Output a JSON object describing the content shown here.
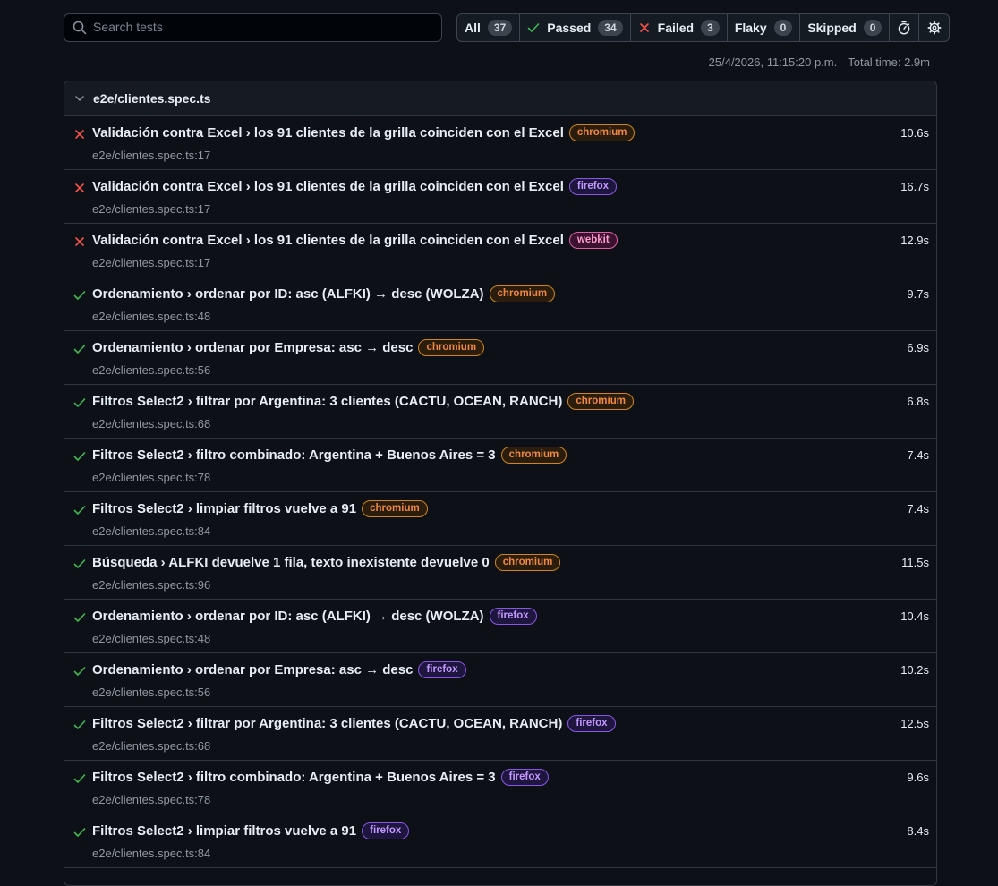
{
  "search": {
    "placeholder": "Search tests",
    "value": ""
  },
  "filters": [
    {
      "id": "all",
      "label": "All",
      "count": "37"
    },
    {
      "id": "passed",
      "label": "Passed",
      "count": "34"
    },
    {
      "id": "failed",
      "label": "Failed",
      "count": "3"
    },
    {
      "id": "flaky",
      "label": "Flaky",
      "count": "0"
    },
    {
      "id": "skipped",
      "label": "Skipped",
      "count": "0"
    }
  ],
  "meta": {
    "timestamp": "25/4/2026, 11:15:20 p.m.",
    "total_time": "Total time: 2.9m"
  },
  "file": {
    "name": "e2e/clientes.spec.ts",
    "tests": [
      {
        "status": "failed",
        "title": "Validación contra Excel › los 91 clientes de la grilla coinciden con el Excel",
        "project": "chromium",
        "location": "e2e/clientes.spec.ts:17",
        "duration": "10.6s"
      },
      {
        "status": "failed",
        "title": "Validación contra Excel › los 91 clientes de la grilla coinciden con el Excel",
        "project": "firefox",
        "location": "e2e/clientes.spec.ts:17",
        "duration": "16.7s"
      },
      {
        "status": "failed",
        "title": "Validación contra Excel › los 91 clientes de la grilla coinciden con el Excel",
        "project": "webkit",
        "location": "e2e/clientes.spec.ts:17",
        "duration": "12.9s"
      },
      {
        "status": "passed",
        "title": "Ordenamiento › ordenar por ID: asc (ALFKI) → desc (WOLZA)",
        "project": "chromium",
        "location": "e2e/clientes.spec.ts:48",
        "duration": "9.7s"
      },
      {
        "status": "passed",
        "title": "Ordenamiento › ordenar por Empresa: asc → desc",
        "project": "chromium",
        "location": "e2e/clientes.spec.ts:56",
        "duration": "6.9s"
      },
      {
        "status": "passed",
        "title": "Filtros Select2 › filtrar por Argentina: 3 clientes (CACTU, OCEAN, RANCH)",
        "project": "chromium",
        "location": "e2e/clientes.spec.ts:68",
        "duration": "6.8s"
      },
      {
        "status": "passed",
        "title": "Filtros Select2 › filtro combinado: Argentina + Buenos Aires = 3",
        "project": "chromium",
        "location": "e2e/clientes.spec.ts:78",
        "duration": "7.4s"
      },
      {
        "status": "passed",
        "title": "Filtros Select2 › limpiar filtros vuelve a 91",
        "project": "chromium",
        "location": "e2e/clientes.spec.ts:84",
        "duration": "7.4s"
      },
      {
        "status": "passed",
        "title": "Búsqueda › ALFKI devuelve 1 fila, texto inexistente devuelve 0",
        "project": "chromium",
        "location": "e2e/clientes.spec.ts:96",
        "duration": "11.5s"
      },
      {
        "status": "passed",
        "title": "Ordenamiento › ordenar por ID: asc (ALFKI) → desc (WOLZA)",
        "project": "firefox",
        "location": "e2e/clientes.spec.ts:48",
        "duration": "10.4s"
      },
      {
        "status": "passed",
        "title": "Ordenamiento › ordenar por Empresa: asc → desc",
        "project": "firefox",
        "location": "e2e/clientes.spec.ts:56",
        "duration": "10.2s"
      },
      {
        "status": "passed",
        "title": "Filtros Select2 › filtrar por Argentina: 3 clientes (CACTU, OCEAN, RANCH)",
        "project": "firefox",
        "location": "e2e/clientes.spec.ts:68",
        "duration": "12.5s"
      },
      {
        "status": "passed",
        "title": "Filtros Select2 › filtro combinado: Argentina + Buenos Aires = 3",
        "project": "firefox",
        "location": "e2e/clientes.spec.ts:78",
        "duration": "9.6s"
      },
      {
        "status": "passed",
        "title": "Filtros Select2 › limpiar filtros vuelve a 91",
        "project": "firefox",
        "location": "e2e/clientes.spec.ts:84",
        "duration": "8.4s"
      }
    ]
  },
  "colors": {
    "passed": "#3fb950",
    "failed": "#f85149",
    "background": "#0d1117"
  }
}
